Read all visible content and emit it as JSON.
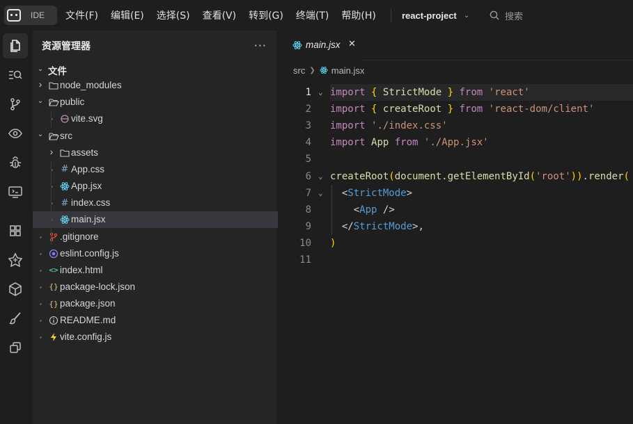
{
  "titlebar": {
    "logo_text": "IDE",
    "menu": [
      "文件(F)",
      "编辑(E)",
      "选择(S)",
      "查看(V)",
      "转到(G)",
      "终端(T)",
      "帮助(H)"
    ],
    "project": "react-project",
    "search_placeholder": "搜索"
  },
  "activitybar": {
    "items": [
      "explorer-icon",
      "search-icon",
      "source-control-icon",
      "preview-icon",
      "debug-icon",
      "remote-icon",
      "extensions-icon",
      "ai-icon",
      "package-icon",
      "brush-icon",
      "copy-icon"
    ]
  },
  "sidebar": {
    "title": "资源管理器",
    "more": "···",
    "root": "文件",
    "tree": [
      {
        "label": "node_modules",
        "type": "folder",
        "depth": 1,
        "expanded": false
      },
      {
        "label": "public",
        "type": "folder",
        "depth": 1,
        "expanded": true
      },
      {
        "label": "vite.svg",
        "type": "svg",
        "depth": 2
      },
      {
        "label": "src",
        "type": "folder",
        "depth": 1,
        "expanded": true
      },
      {
        "label": "assets",
        "type": "folder",
        "depth": 2,
        "expanded": false
      },
      {
        "label": "App.css",
        "type": "css",
        "depth": 2
      },
      {
        "label": "App.jsx",
        "type": "jsx",
        "depth": 2
      },
      {
        "label": "index.css",
        "type": "css",
        "depth": 2
      },
      {
        "label": "main.jsx",
        "type": "jsx",
        "depth": 2,
        "selected": true
      },
      {
        "label": ".gitignore",
        "type": "git",
        "depth": 1
      },
      {
        "label": "eslint.config.js",
        "type": "eslint",
        "depth": 1
      },
      {
        "label": "index.html",
        "type": "html",
        "depth": 1
      },
      {
        "label": "package-lock.json",
        "type": "json",
        "depth": 1
      },
      {
        "label": "package.json",
        "type": "json",
        "depth": 1
      },
      {
        "label": "README.md",
        "type": "info",
        "depth": 1
      },
      {
        "label": "vite.config.js",
        "type": "vite",
        "depth": 1
      }
    ]
  },
  "editor": {
    "tab_label": "main.jsx",
    "tab_close": "✕",
    "breadcrumb": [
      "src",
      "main.jsx"
    ],
    "lines": [
      {
        "n": "1",
        "fold": true,
        "tokens": [
          [
            "k",
            "import"
          ],
          [
            "p",
            " "
          ],
          [
            "b",
            "{"
          ],
          [
            "p",
            " "
          ],
          [
            "f",
            "StrictMode"
          ],
          [
            "p",
            " "
          ],
          [
            "b",
            "}"
          ],
          [
            "p",
            " "
          ],
          [
            "k",
            "from"
          ],
          [
            "p",
            " "
          ],
          [
            "s",
            "'react'"
          ]
        ]
      },
      {
        "n": "2",
        "fold": false,
        "tokens": [
          [
            "k",
            "import"
          ],
          [
            "p",
            " "
          ],
          [
            "b",
            "{"
          ],
          [
            "p",
            " "
          ],
          [
            "f",
            "createRoot"
          ],
          [
            "p",
            " "
          ],
          [
            "b",
            "}"
          ],
          [
            "p",
            " "
          ],
          [
            "k",
            "from"
          ],
          [
            "p",
            " "
          ],
          [
            "s",
            "'react-dom/client'"
          ]
        ]
      },
      {
        "n": "3",
        "fold": false,
        "tokens": [
          [
            "k",
            "import"
          ],
          [
            "p",
            " "
          ],
          [
            "s",
            "'./index.css'"
          ]
        ]
      },
      {
        "n": "4",
        "fold": false,
        "tokens": [
          [
            "k",
            "import"
          ],
          [
            "p",
            " "
          ],
          [
            "f",
            "App"
          ],
          [
            "p",
            " "
          ],
          [
            "k",
            "from"
          ],
          [
            "p",
            " "
          ],
          [
            "s",
            "'./App.jsx'"
          ]
        ]
      },
      {
        "n": "5",
        "fold": false,
        "tokens": []
      },
      {
        "n": "6",
        "fold": true,
        "tokens": [
          [
            "f",
            "createRoot"
          ],
          [
            "b",
            "("
          ],
          [
            "f",
            "document"
          ],
          [
            "p",
            "."
          ],
          [
            "f",
            "getElementById"
          ],
          [
            "b",
            "("
          ],
          [
            "s",
            "'root'"
          ],
          [
            "b",
            "))"
          ],
          [
            "p",
            "."
          ],
          [
            "f",
            "render"
          ],
          [
            "b",
            "("
          ]
        ]
      },
      {
        "n": "7",
        "fold": true,
        "tokens": [
          [
            "p",
            "  "
          ],
          [
            "t",
            "<"
          ],
          [
            "c",
            "StrictMode"
          ],
          [
            "t",
            ">"
          ]
        ]
      },
      {
        "n": "8",
        "fold": false,
        "tokens": [
          [
            "p",
            "    "
          ],
          [
            "t",
            "<"
          ],
          [
            "c",
            "App"
          ],
          [
            "p",
            " "
          ],
          [
            "t",
            "/>"
          ]
        ]
      },
      {
        "n": "9",
        "fold": false,
        "tokens": [
          [
            "p",
            "  "
          ],
          [
            "t",
            "</"
          ],
          [
            "c",
            "StrictMode"
          ],
          [
            "t",
            ">"
          ],
          [
            "p",
            ","
          ]
        ]
      },
      {
        "n": "10",
        "fold": false,
        "tokens": [
          [
            "b",
            ")"
          ]
        ]
      },
      {
        "n": "11",
        "fold": false,
        "tokens": []
      }
    ]
  }
}
